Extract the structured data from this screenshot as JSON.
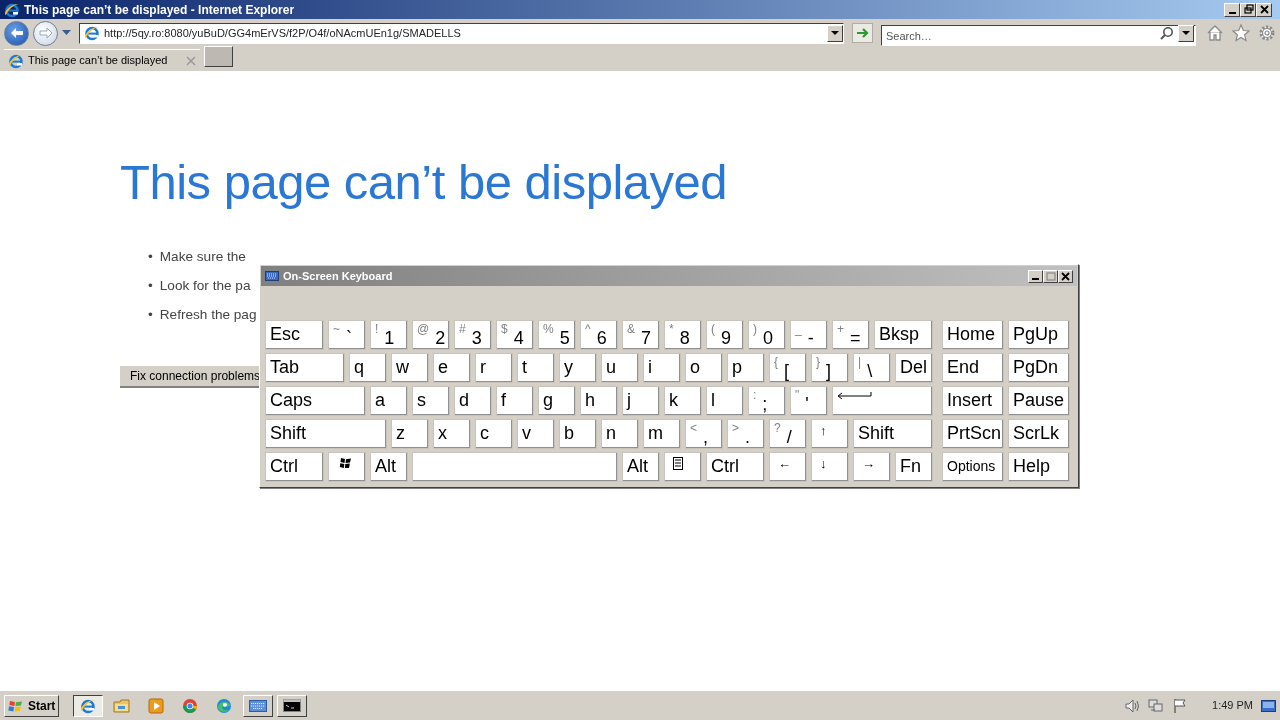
{
  "window": {
    "title": "This page can’t be displayed - Internet Explorer"
  },
  "address_bar": {
    "value": "http://5qy.ro:8080/yuBuD/GG4mErVS/f2P/O4f/oNAcmUEn1g/SMADELLS"
  },
  "search": {
    "placeholder": "Search…"
  },
  "tabs": [
    {
      "label": "This page can’t be displayed",
      "selected": true
    }
  ],
  "page": {
    "heading": "This page can’t be displayed",
    "bullets": [
      {
        "marker": "•",
        "text": "Make sure the"
      },
      {
        "marker": "•",
        "text": "Look for the pa"
      },
      {
        "marker": "•",
        "text": "Refresh the pag"
      }
    ],
    "button": "Fix connection problems"
  },
  "keyboard_window": {
    "title": "On-Screen Keyboard",
    "key_rows": [
      [
        {
          "kind": "text",
          "label": "Esc"
        },
        {
          "kind": "dual",
          "shift": "~",
          "label": "`"
        },
        {
          "kind": "dual",
          "shift": "!",
          "label": "1"
        },
        {
          "kind": "dual",
          "shift": "@",
          "label": "2"
        },
        {
          "kind": "dual",
          "shift": "#",
          "label": "3"
        },
        {
          "kind": "dual",
          "shift": "$",
          "label": "4"
        },
        {
          "kind": "dual",
          "shift": "%",
          "label": "5"
        },
        {
          "kind": "dual",
          "shift": "^",
          "label": "6"
        },
        {
          "kind": "dual",
          "shift": "&",
          "label": "7"
        },
        {
          "kind": "dual",
          "shift": "*",
          "label": "8"
        },
        {
          "kind": "dual",
          "shift": "(",
          "label": "9"
        },
        {
          "kind": "dual",
          "shift": ")",
          "label": "0"
        },
        {
          "kind": "dual",
          "shift": "_",
          "label": "-"
        },
        {
          "kind": "dual",
          "shift": "+",
          "label": "="
        },
        {
          "kind": "text",
          "label": "Bksp"
        },
        {
          "kind": "text",
          "label": "Home"
        },
        {
          "kind": "text",
          "label": "PgUp"
        }
      ],
      [
        {
          "kind": "text",
          "label": "Tab"
        },
        {
          "kind": "text",
          "label": "q"
        },
        {
          "kind": "text",
          "label": "w"
        },
        {
          "kind": "text",
          "label": "e"
        },
        {
          "kind": "text",
          "label": "r"
        },
        {
          "kind": "text",
          "label": "t"
        },
        {
          "kind": "text",
          "label": "y"
        },
        {
          "kind": "text",
          "label": "u"
        },
        {
          "kind": "text",
          "label": "i"
        },
        {
          "kind": "text",
          "label": "o"
        },
        {
          "kind": "text",
          "label": "p"
        },
        {
          "kind": "dual",
          "shift": "{",
          "label": "["
        },
        {
          "kind": "dual",
          "shift": "}",
          "label": "]"
        },
        {
          "kind": "dual",
          "shift": "|",
          "label": "\\"
        },
        {
          "kind": "text",
          "label": "Del"
        },
        {
          "kind": "text",
          "label": "End"
        },
        {
          "kind": "text",
          "label": "PgDn"
        }
      ],
      [
        {
          "kind": "text",
          "label": "Caps"
        },
        {
          "kind": "text",
          "label": "a"
        },
        {
          "kind": "text",
          "label": "s"
        },
        {
          "kind": "text",
          "label": "d"
        },
        {
          "kind": "text",
          "label": "f"
        },
        {
          "kind": "text",
          "label": "g"
        },
        {
          "kind": "text",
          "label": "h"
        },
        {
          "kind": "text",
          "label": "j"
        },
        {
          "kind": "text",
          "label": "k"
        },
        {
          "kind": "text",
          "label": "l"
        },
        {
          "kind": "dual",
          "shift": ":",
          "label": ";"
        },
        {
          "kind": "dual",
          "shift": "\"",
          "label": "'"
        },
        {
          "kind": "enter"
        },
        {
          "kind": "text",
          "label": "Insert"
        },
        {
          "kind": "text",
          "label": "Pause"
        }
      ],
      [
        {
          "kind": "text",
          "label": "Shift"
        },
        {
          "kind": "text",
          "label": "z"
        },
        {
          "kind": "text",
          "label": "x"
        },
        {
          "kind": "text",
          "label": "c"
        },
        {
          "kind": "text",
          "label": "v"
        },
        {
          "kind": "text",
          "label": "b"
        },
        {
          "kind": "text",
          "label": "n"
        },
        {
          "kind": "text",
          "label": "m"
        },
        {
          "kind": "dual",
          "shift": "<",
          "label": ","
        },
        {
          "kind": "dual",
          "shift": ">",
          "label": "."
        },
        {
          "kind": "dual",
          "shift": "?",
          "label": "/"
        },
        {
          "kind": "small",
          "label": "↑"
        },
        {
          "kind": "text",
          "label": "Shift"
        },
        {
          "kind": "text",
          "label": "PrtScn"
        },
        {
          "kind": "text",
          "label": "ScrLk"
        }
      ],
      [
        {
          "kind": "text",
          "label": "Ctrl"
        },
        {
          "kind": "windows"
        },
        {
          "kind": "text",
          "label": "Alt"
        },
        {
          "kind": "space"
        },
        {
          "kind": "text",
          "label": "Alt"
        },
        {
          "kind": "menu"
        },
        {
          "kind": "text",
          "label": "Ctrl"
        },
        {
          "kind": "small",
          "label": "←"
        },
        {
          "kind": "small",
          "label": "↓"
        },
        {
          "kind": "small",
          "label": "→"
        },
        {
          "kind": "text",
          "label": "Fn"
        },
        {
          "kind": "options",
          "label": "Options"
        },
        {
          "kind": "text",
          "label": "Help"
        }
      ]
    ]
  },
  "taskbar": {
    "start": "Start",
    "items": [
      {
        "kind": "ie",
        "open": true,
        "selected": true
      },
      {
        "kind": "folder",
        "open": false,
        "selected": false
      },
      {
        "kind": "media",
        "open": false,
        "selected": false
      },
      {
        "kind": "chrome",
        "open": false,
        "selected": false
      },
      {
        "kind": "edge",
        "open": false,
        "selected": false
      },
      {
        "kind": "keyboard",
        "open": true,
        "selected": false
      },
      {
        "kind": "console",
        "open": true,
        "selected": false
      }
    ],
    "clock": "1:49 PM"
  }
}
